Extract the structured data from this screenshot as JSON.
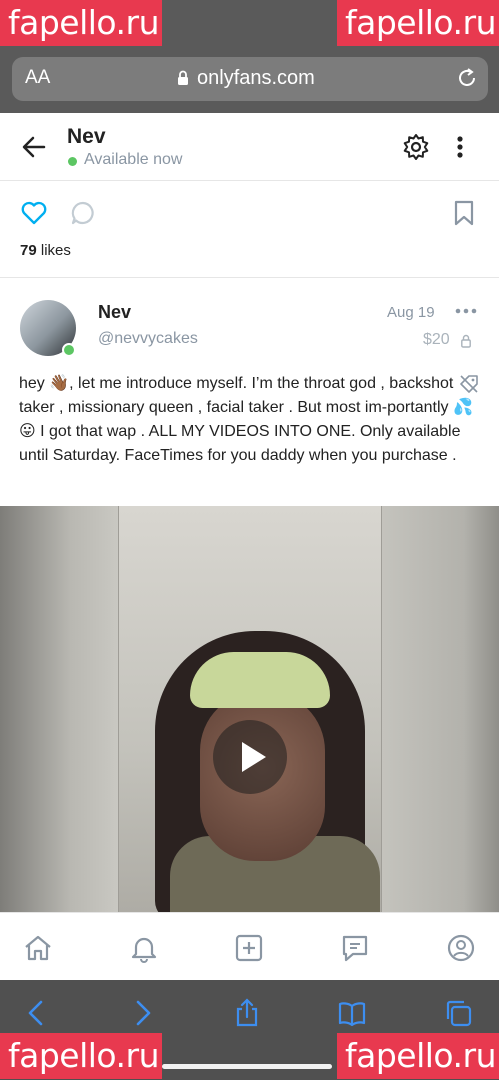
{
  "watermark": "fapello.ru",
  "browser": {
    "text_size_label": "AA",
    "url": "onlyfans.com"
  },
  "header": {
    "name": "Nev",
    "status": "Available now"
  },
  "actions": {
    "likes_count": "79",
    "likes_label": "likes"
  },
  "post": {
    "author_name": "Nev",
    "author_handle": "@nevvycakes",
    "date": "Aug 19",
    "price": "$20",
    "text": "hey 👋🏾, let me introduce myself. I’m the throat god , backshot taker , missionary queen , facial taker . But most im-portantly 💦😛 I got that wap . ALL MY VIDEOS INTO ONE. Only available until Saturday. FaceTimes for you daddy when you purchase ."
  },
  "colors": {
    "accent": "#00aff0",
    "online": "#5cc663",
    "muted": "#8a96a3",
    "watermark_bg": "#e8394f",
    "safari_bar": "#505050"
  },
  "icons": {
    "bottom_nav": [
      "home-icon",
      "bell-icon",
      "add-post-icon",
      "messages-icon",
      "profile-icon"
    ],
    "safari_toolbar": [
      "back-icon",
      "forward-icon",
      "share-icon",
      "bookmarks-icon",
      "tabs-icon"
    ]
  }
}
